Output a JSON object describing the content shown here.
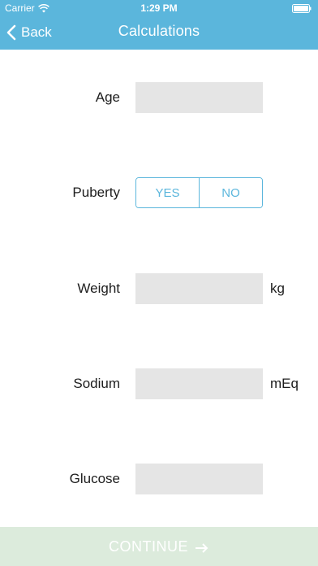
{
  "status_bar": {
    "carrier": "Carrier",
    "time": "1:29 PM",
    "icons": [
      "wifi-icon",
      "battery-icon"
    ]
  },
  "nav": {
    "back_label": "Back",
    "title": "Calculations"
  },
  "form": {
    "age": {
      "label": "Age",
      "value": ""
    },
    "puberty": {
      "label": "Puberty",
      "options": [
        "YES",
        "NO"
      ]
    },
    "weight": {
      "label": "Weight",
      "value": "",
      "unit": "kg"
    },
    "sodium": {
      "label": "Sodium",
      "value": "",
      "unit": "mEq"
    },
    "glucose": {
      "label": "Glucose",
      "value": ""
    }
  },
  "footer": {
    "continue_label": "CONTINUE"
  },
  "colors": {
    "header": "#5bb6dc",
    "segment_accent": "#5bb6dc",
    "field_bg": "#e5e5e5",
    "continue_bg": "#dcebdc"
  }
}
